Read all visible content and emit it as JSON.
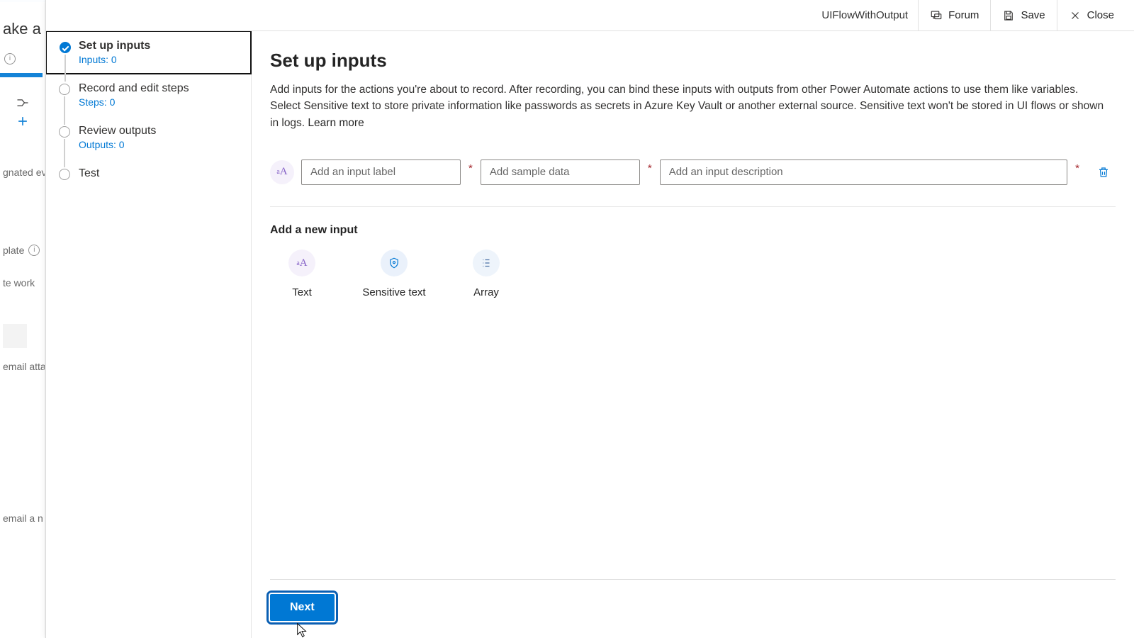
{
  "background": {
    "title_fragment": "ake a fl",
    "items": [
      "gnated even",
      "plate",
      "te work",
      "email attac",
      "email a n"
    ]
  },
  "header": {
    "flow_name": "UIFlowWithOutput",
    "forum": "Forum",
    "save": "Save",
    "close": "Close"
  },
  "steps": [
    {
      "title": "Set up inputs",
      "sub": "Inputs: 0",
      "active": true
    },
    {
      "title": "Record and edit steps",
      "sub": "Steps: 0",
      "active": false
    },
    {
      "title": "Review outputs",
      "sub": "Outputs: 0",
      "active": false
    },
    {
      "title": "Test",
      "sub": "",
      "active": false
    }
  ],
  "content": {
    "heading": "Set up inputs",
    "description": "Add inputs for the actions you're about to record. After recording, you can bind these inputs with outputs from other Power Automate actions to use them like variables. Select Sensitive text to store private information like passwords as secrets in Azure Key Vault or another external source. Sensitive text won't be stored in UI flows or shown in logs. ",
    "learn_more": "Learn more",
    "row": {
      "label_ph": "Add an input label",
      "sample_ph": "Add sample data",
      "desc_ph": "Add an input description"
    },
    "addnew_heading": "Add a new input",
    "types": {
      "text": "Text",
      "sensitive": "Sensitive text",
      "array": "Array"
    }
  },
  "footer": {
    "next": "Next"
  }
}
